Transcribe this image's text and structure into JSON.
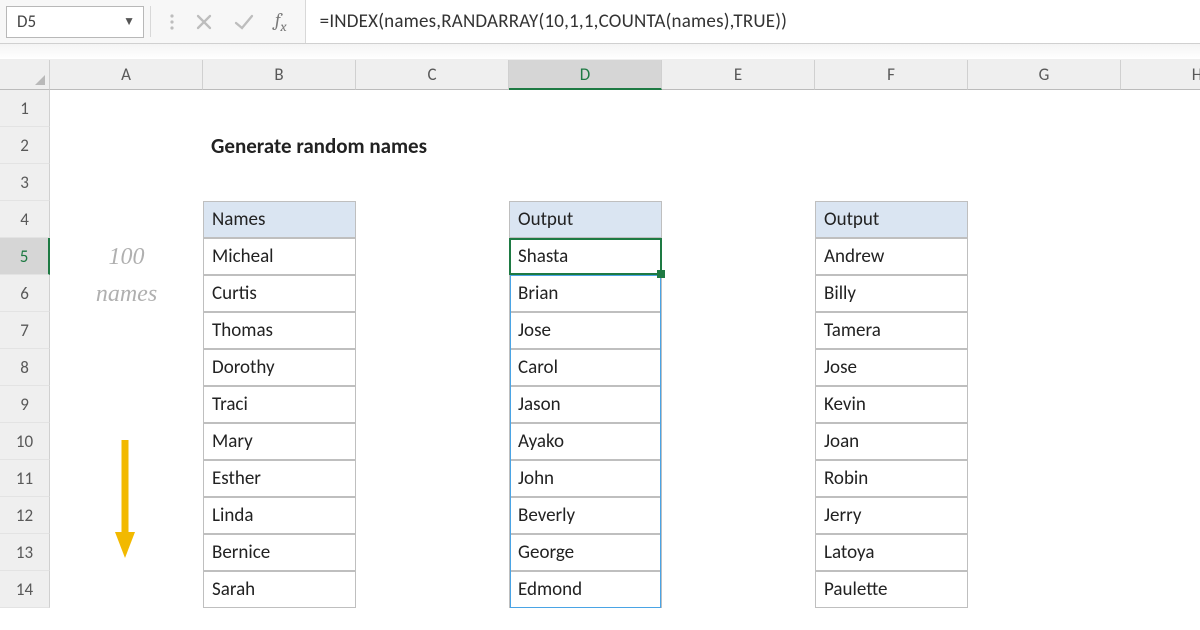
{
  "cellRef": "D5",
  "formula": "=INDEX(names,RANDARRAY(10,1,1,COUNTA(names),TRUE))",
  "columns": [
    "A",
    "B",
    "C",
    "D",
    "E",
    "F",
    "G",
    "H"
  ],
  "activeCol": "D",
  "rowNums": [
    1,
    2,
    3,
    4,
    5,
    6,
    7,
    8,
    9,
    10,
    11,
    12,
    13,
    14
  ],
  "activeRow": 5,
  "title": "Generate random names",
  "annot1": "100",
  "annot2": "names",
  "headers": {
    "names": "Names",
    "output1": "Output",
    "output2": "Output"
  },
  "colB": [
    "Micheal",
    "Curtis",
    "Thomas",
    "Dorothy",
    "Traci",
    "Mary",
    "Esther",
    "Linda",
    "Bernice",
    "Sarah"
  ],
  "colD": [
    "Shasta",
    "Brian",
    "Jose",
    "Carol",
    "Jason",
    "Ayako",
    "John",
    "Beverly",
    "George",
    "Edmond"
  ],
  "colF": [
    "Andrew",
    "Billy",
    "Tamera",
    "Jose",
    "Kevin",
    "Joan",
    "Robin",
    "Jerry",
    "Latoya",
    "Paulette"
  ],
  "colors": {
    "accent": "#1e7a43",
    "spill": "#4aa4e5",
    "header": "#dae5f2",
    "annot": "#b0b0b0",
    "arrow": "#f2b900"
  },
  "chart_data": {
    "type": "table",
    "title": "Generate random names",
    "columns": [
      "Names",
      "Output",
      "Output"
    ],
    "rows": [
      [
        "Micheal",
        "Shasta",
        "Andrew"
      ],
      [
        "Curtis",
        "Brian",
        "Billy"
      ],
      [
        "Thomas",
        "Jose",
        "Tamera"
      ],
      [
        "Dorothy",
        "Carol",
        "Jose"
      ],
      [
        "Traci",
        "Jason",
        "Kevin"
      ],
      [
        "Mary",
        "Ayako",
        "Joan"
      ],
      [
        "Esther",
        "John",
        "Robin"
      ],
      [
        "Linda",
        "Beverly",
        "Jerry"
      ],
      [
        "Bernice",
        "George",
        "Latoya"
      ],
      [
        "Sarah",
        "Edmond",
        "Paulette"
      ]
    ]
  }
}
